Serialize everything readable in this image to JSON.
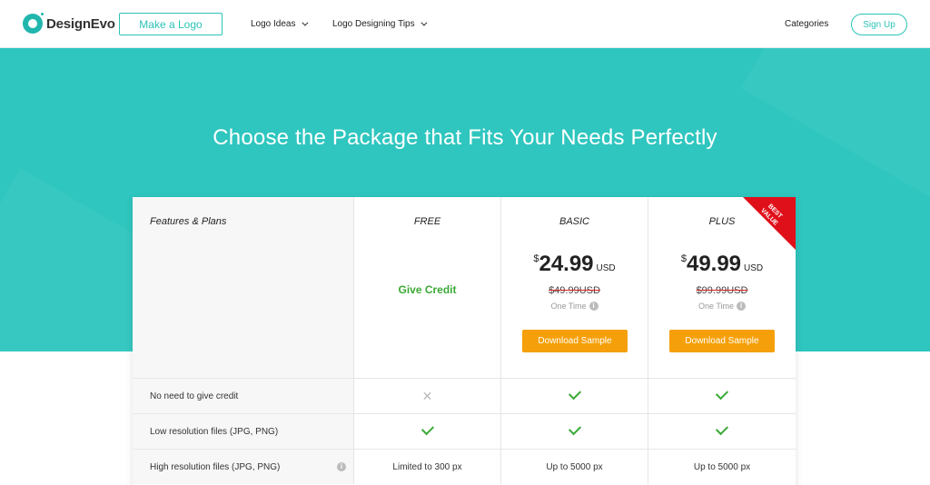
{
  "header": {
    "brand": "DesignEvo",
    "make_logo": "Make a Logo",
    "nav": [
      {
        "label": "Logo Ideas"
      },
      {
        "label": "Logo Designing Tips"
      }
    ],
    "categories": "Categories",
    "signup": "Sign Up"
  },
  "hero": {
    "title": "Choose the Package that Fits Your Needs Perfectly"
  },
  "plans": {
    "features_label": "Features & Plans",
    "free": {
      "name": "FREE",
      "note": "Give Credit"
    },
    "basic": {
      "name": "BASIC",
      "currency": "$",
      "price": "24.99",
      "unit": "USD",
      "old_price": "$49.99USD",
      "period": "One Time",
      "button": "Download Sample"
    },
    "plus": {
      "name": "PLUS",
      "currency": "$",
      "price": "49.99",
      "unit": "USD",
      "old_price": "$99.99USD",
      "period": "One Time",
      "button": "Download Sample",
      "badge": "BEST VALUE"
    }
  },
  "rows": [
    {
      "feature": "No need to give credit",
      "free": "cross",
      "basic": "check",
      "plus": "check"
    },
    {
      "feature": "Low resolution files (JPG, PNG)",
      "free": "check",
      "basic": "check",
      "plus": "check"
    },
    {
      "feature": "High resolution files (JPG, PNG)",
      "free": "Limited to 300 px",
      "basic": "Up to 5000 px",
      "plus": "Up to 5000 px"
    }
  ],
  "colors": {
    "accent": "#2fc6bf",
    "button": "#f5a00a",
    "check": "#3aa935",
    "badge": "#e0101a"
  }
}
